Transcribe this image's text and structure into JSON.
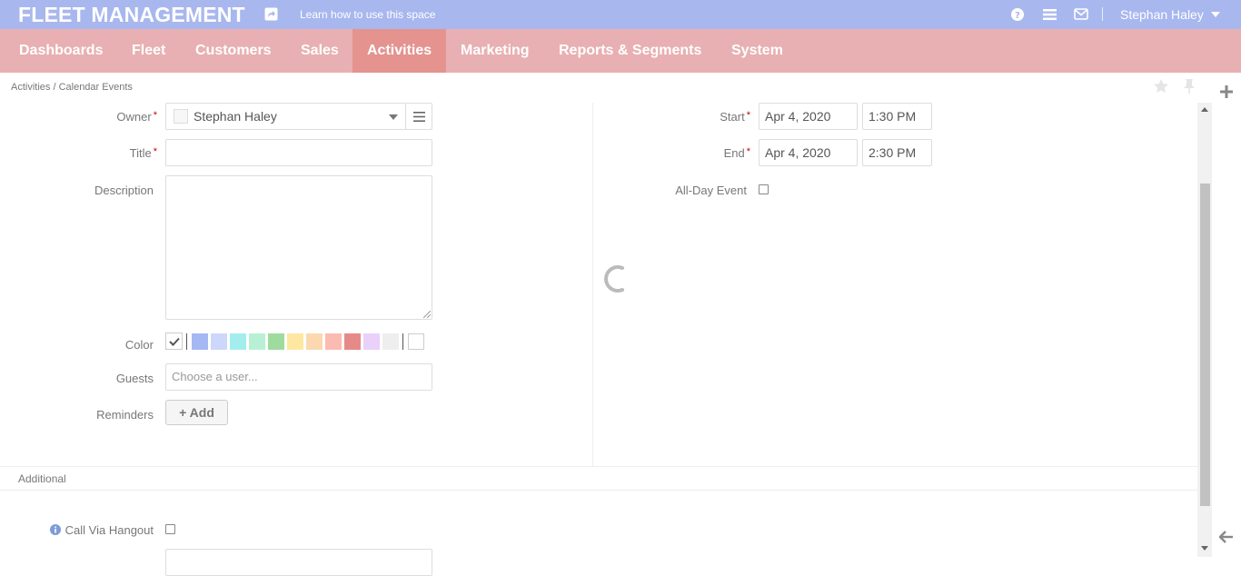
{
  "topbar": {
    "brand": "FLEET MANAGEMENT",
    "learn_link": "Learn how to use this space",
    "user_name": "Stephan Haley",
    "background": "#a8b7ee"
  },
  "icons": {
    "share": "share-icon",
    "help": "help-icon",
    "menu": "menu-icon",
    "mail": "mail-icon",
    "star": "star-icon",
    "pin": "pin-icon",
    "plus": "plus-icon",
    "back": "back-arrow-icon",
    "info": "info-icon",
    "check": "check-icon"
  },
  "nav": {
    "background": "#e8b0b2",
    "active_background": "#e4938f",
    "items": [
      {
        "label": "Dashboards"
      },
      {
        "label": "Fleet"
      },
      {
        "label": "Customers"
      },
      {
        "label": "Sales"
      },
      {
        "label": "Activities",
        "active": true
      },
      {
        "label": "Marketing"
      },
      {
        "label": "Reports & Segments"
      },
      {
        "label": "System"
      }
    ]
  },
  "breadcrumb": "Activities / Calendar Events",
  "form": {
    "owner_label": "Owner",
    "owner_value": "Stephan Haley",
    "title_label": "Title",
    "title_value": "",
    "description_label": "Description",
    "description_value": "",
    "color_label": "Color",
    "colors": [
      "#a4b8f3",
      "#ccd7fb",
      "#a4eded",
      "#b8f0d6",
      "#9edc9d",
      "#fee8a1",
      "#fbd8b0",
      "#fcbbb0",
      "#e68a89",
      "#e9d1fa",
      "#eeeeee"
    ],
    "selected_color": "none",
    "guests_label": "Guests",
    "guests_placeholder": "Choose a user...",
    "reminders_label": "Reminders",
    "add_button": "+ Add",
    "required_mark": "*",
    "start_label": "Start",
    "start_date": "Apr 4, 2020",
    "start_time": "1:30 PM",
    "end_label": "End",
    "end_date": "Apr 4, 2020",
    "end_time": "2:30 PM",
    "all_day_label": "All-Day Event",
    "all_day_checked": false
  },
  "additional": {
    "section_title": "Additional",
    "hangout_label": "Call Via Hangout",
    "hangout_checked": false
  }
}
